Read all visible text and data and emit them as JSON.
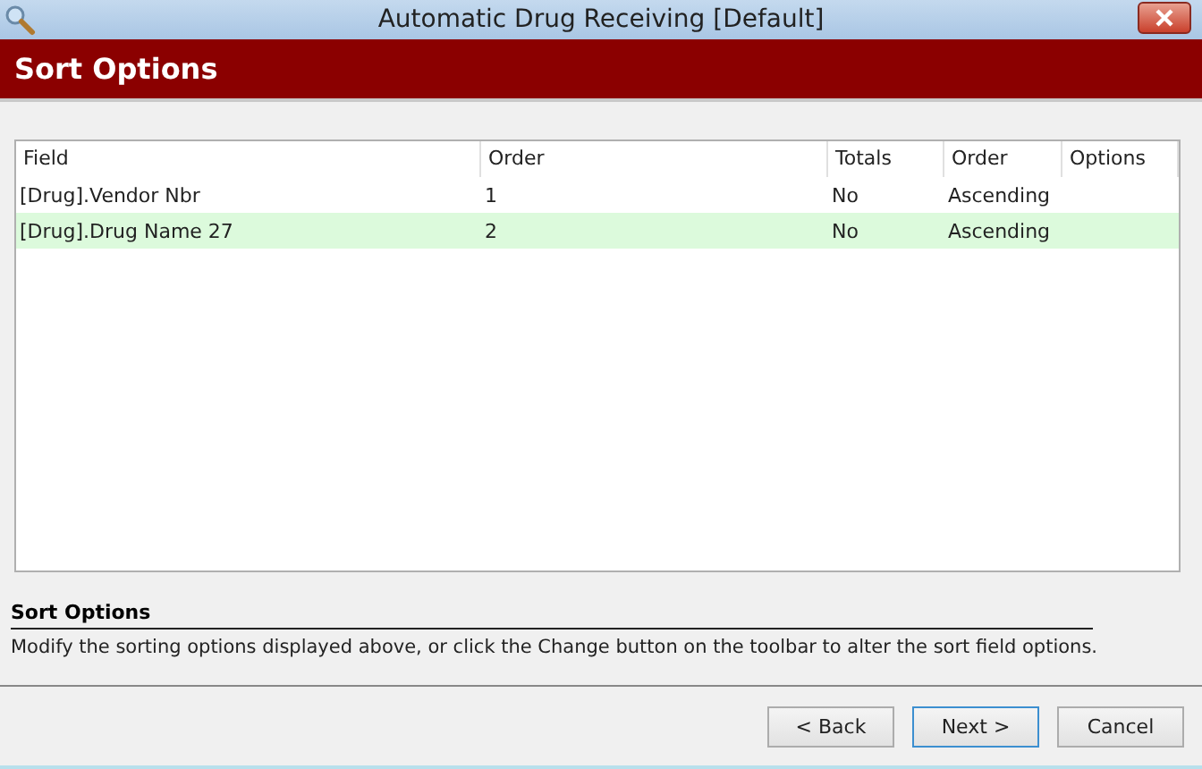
{
  "window": {
    "title": "Automatic Drug Receiving [Default]"
  },
  "header": {
    "title": "Sort Options"
  },
  "table": {
    "columns": [
      "Field",
      "Order",
      "Totals",
      "Order",
      "Options"
    ],
    "rows": [
      {
        "cells": [
          "[Drug].Vendor Nbr",
          "1",
          "No",
          "Ascending",
          ""
        ],
        "selected": false
      },
      {
        "cells": [
          "[Drug].Drug Name 27",
          "2",
          "No",
          "Ascending",
          ""
        ],
        "selected": true
      }
    ]
  },
  "help": {
    "title": "Sort Options",
    "text": "Modify the sorting options displayed above, or click the Change button on the toolbar to alter the sort field options."
  },
  "buttons": [
    {
      "label": "< Back",
      "default": false
    },
    {
      "label": "Next >",
      "default": true
    },
    {
      "label": "Cancel",
      "default": false
    }
  ]
}
